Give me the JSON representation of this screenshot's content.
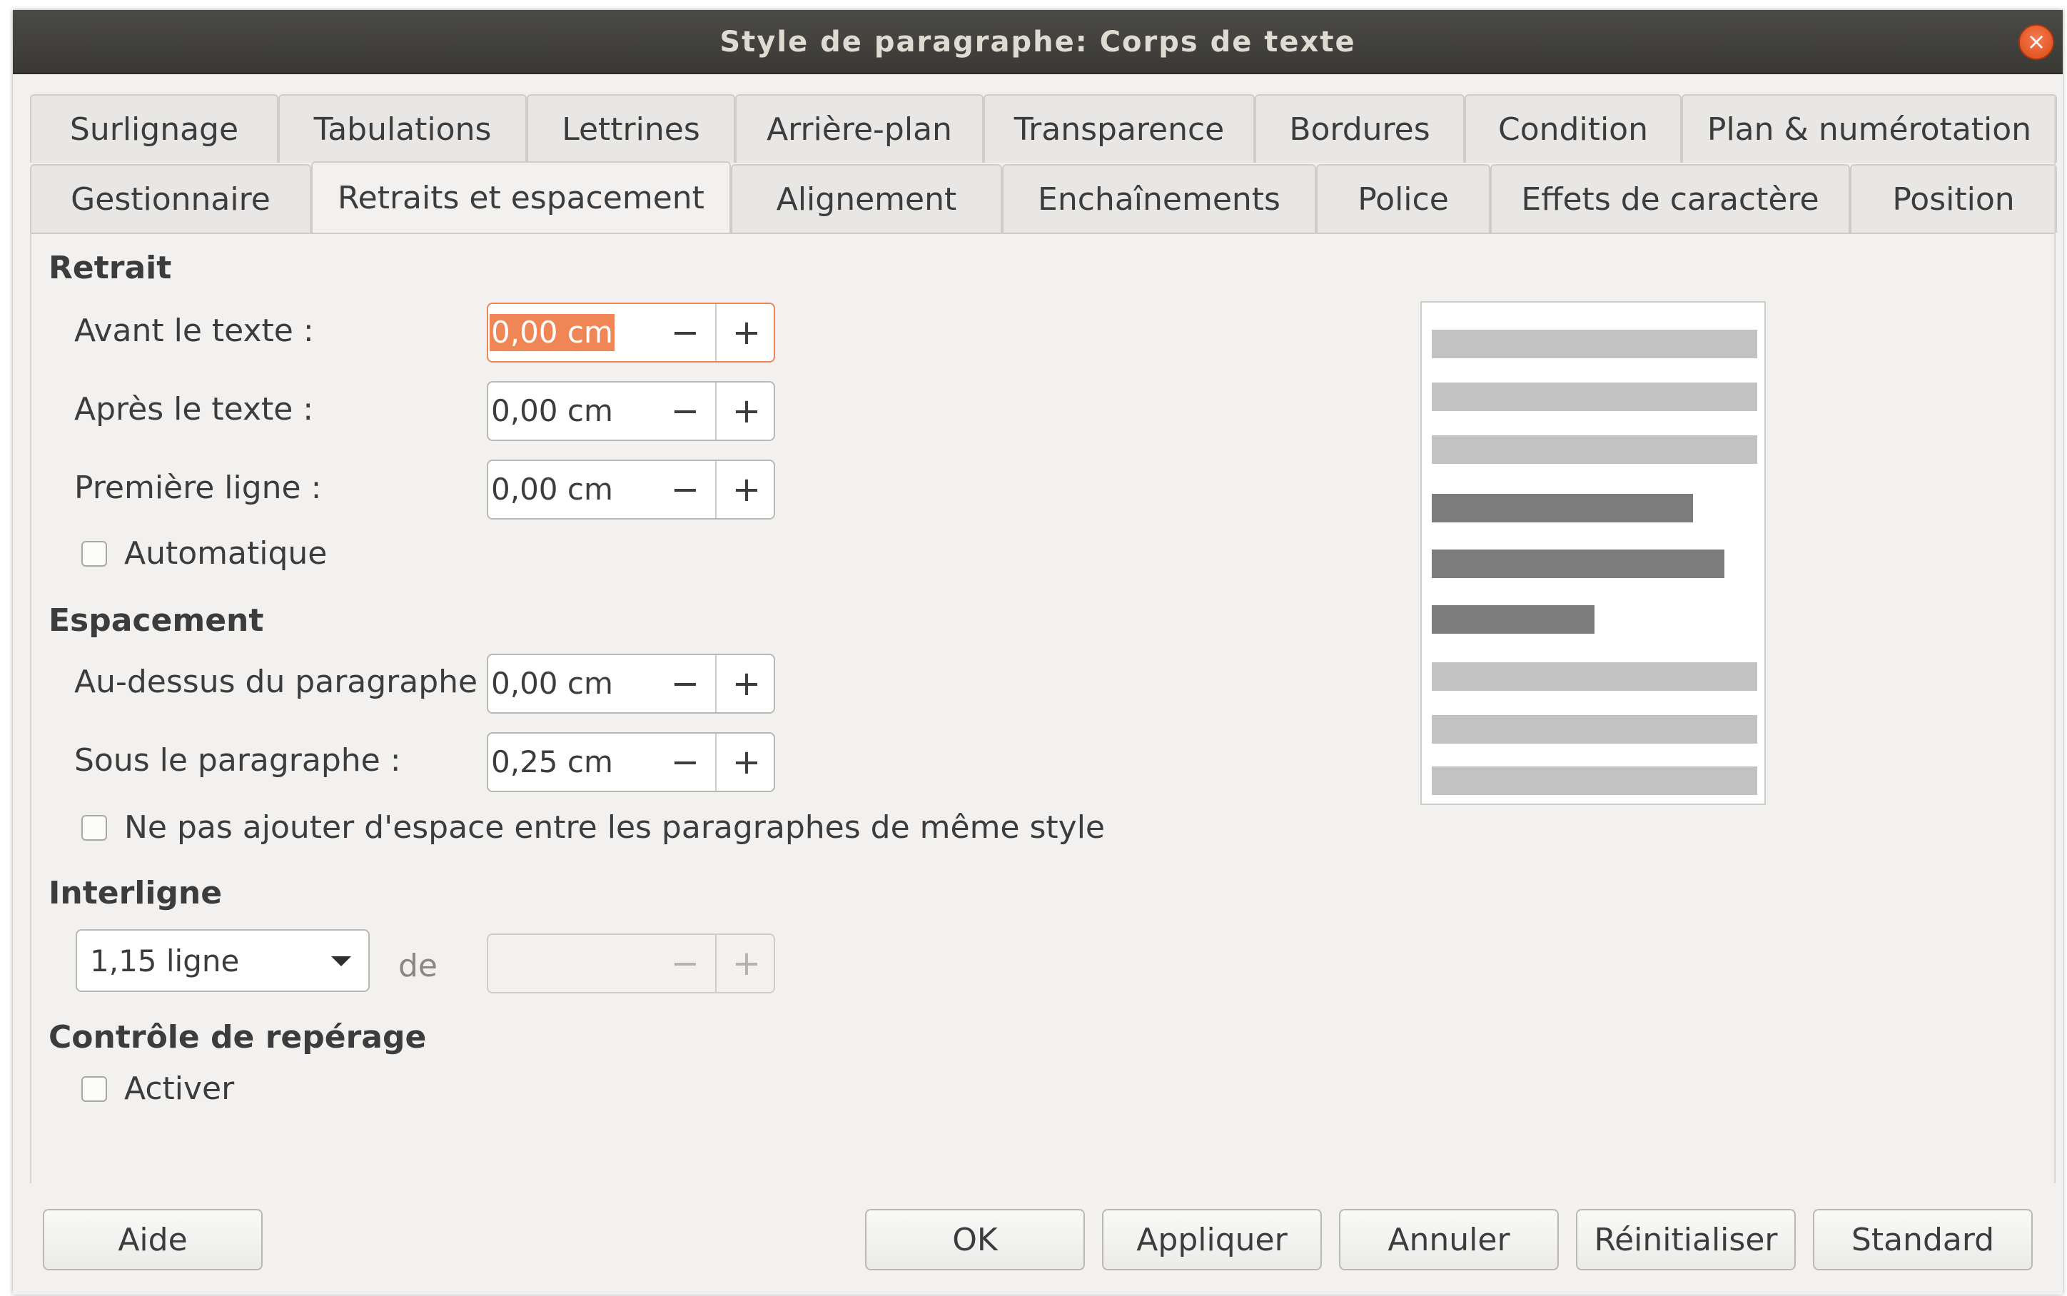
{
  "window": {
    "title": "Style de paragraphe: Corps de texte",
    "close_glyph": "×"
  },
  "tabs_row1": [
    "Surlignage",
    "Tabulations",
    "Lettrines",
    "Arrière-plan",
    "Transparence",
    "Bordures",
    "Condition",
    "Plan & numérotation"
  ],
  "tabs_row2": [
    "Gestionnaire",
    "Retraits et espacement",
    "Alignement",
    "Enchaînements",
    "Police",
    "Effets de caractère",
    "Position"
  ],
  "active_tab": "Retraits et espacement",
  "retrait": {
    "title": "Retrait",
    "avant_label": "Avant le texte :",
    "avant_value": "0,00 cm",
    "apres_label": "Après le texte :",
    "apres_value": "0,00 cm",
    "premiere_label": "Première ligne :",
    "premiere_value": "0,00 cm",
    "auto_label": "Automatique"
  },
  "espacement": {
    "title": "Espacement",
    "dessus_label": "Au-dessus du paragraphe :",
    "dessus_value": "0,00 cm",
    "sous_label": "Sous le paragraphe :",
    "sous_value": "0,25 cm",
    "nospace_label": "Ne pas ajouter d'espace entre les paragraphes de même style"
  },
  "interligne": {
    "title": "Interligne",
    "selected": "1,15 ligne",
    "de_label": "de",
    "de_value": ""
  },
  "reperage": {
    "title": "Contrôle de repérage",
    "activer_label": "Activer"
  },
  "spin_glyphs": {
    "minus": "−",
    "plus": "+"
  },
  "buttons": {
    "aide": "Aide",
    "ok": "OK",
    "appliquer": "Appliquer",
    "annuler": "Annuler",
    "reinitialiser": "Réinitialiser",
    "standard": "Standard"
  },
  "colors": {
    "accent": "#f08655",
    "titlebar": "#3c3b37",
    "close": "#dd4814"
  }
}
